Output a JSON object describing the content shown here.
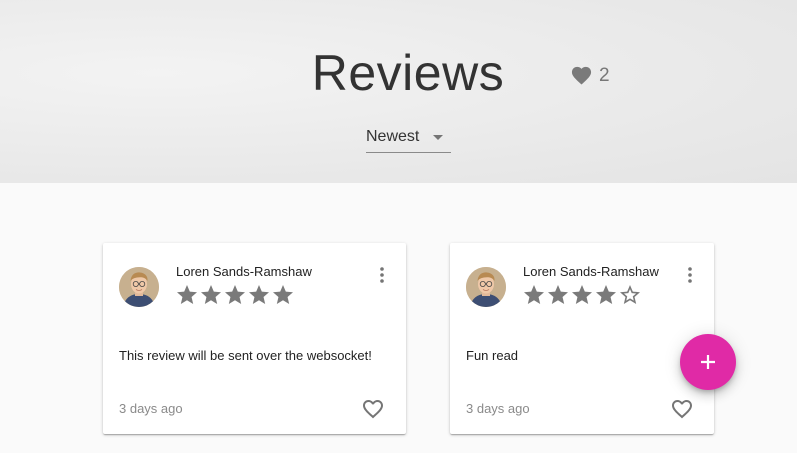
{
  "header": {
    "title": "Reviews",
    "favorite_count": "2",
    "sort": {
      "selected": "Newest"
    }
  },
  "reviews": [
    {
      "author": "Loren Sands-Ramshaw",
      "rating": 5,
      "max_rating": 5,
      "text": "This review will be sent over the websocket!",
      "date": "3 days ago",
      "liked": false
    },
    {
      "author": "Loren Sands-Ramshaw",
      "rating": 4,
      "max_rating": 5,
      "text": "Fun read",
      "date": "3 days ago",
      "liked": false
    }
  ],
  "fab": {
    "icon": "plus-icon"
  },
  "icons": {
    "favorites": "heart-icon",
    "sort": "dropdown-arrow-icon",
    "star_filled": "star-icon",
    "star_empty": "star-outline-icon",
    "menu": "more-vert-icon",
    "like": "heart-outline-icon"
  },
  "colors": {
    "accent": "#e02aa6",
    "star": "#7a7a7a",
    "header_bg": "#e8e8e8",
    "page_bg": "#fafafa"
  }
}
